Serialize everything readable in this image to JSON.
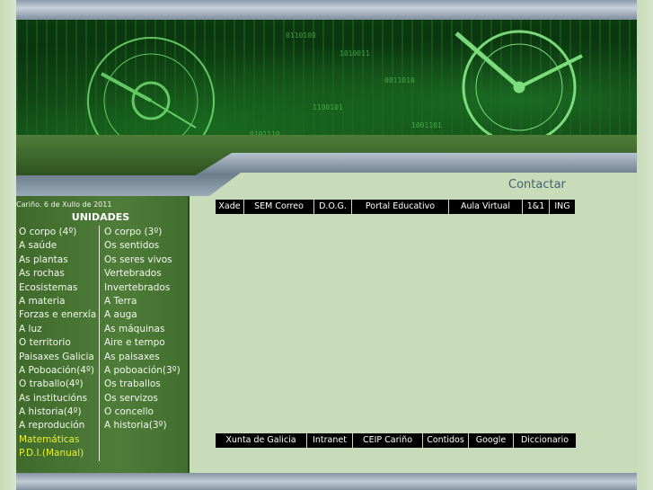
{
  "header": {
    "contact_label": "Contactar"
  },
  "sidebar": {
    "date": "Cariño. 6 de Xullo de 2011",
    "title": "UNIDADES",
    "col1": [
      "O corpo (4º)",
      "A saúde",
      "As plantas",
      "As rochas",
      "Ecosistemas",
      "A materia",
      "Forzas e enerxía",
      "A luz",
      "O territorio",
      "Paisaxes Galicia",
      "A Poboación(4º)",
      "O traballo(4º)",
      "As institucións",
      "A historia(4º)",
      "A reprodución",
      "Matemáticas",
      "P.D.I.(Manual)"
    ],
    "col2": [
      "O corpo (3º)",
      "Os sentidos",
      "Os seres vivos",
      "Vertebrados",
      "Invertebrados",
      "A Terra",
      "A auga",
      "As máquinas",
      "Aire e tempo",
      "As paisaxes",
      "A poboación(3º)",
      "Os traballos",
      "Os servizos",
      "O concello",
      "A historia(3º)"
    ]
  },
  "top_links": [
    "Xade",
    "SEM Correo",
    "D.O.G.",
    "Portal Educativo",
    "Aula Virtual",
    "1&1",
    "ING"
  ],
  "bottom_links": [
    "Xunta de Galicia",
    "Intranet",
    "CEIP Cariño",
    "Contidos",
    "Google",
    "Diccionario"
  ],
  "colors": {
    "page_bg": "#c9dcb9",
    "sidebar_bg": "#4f7d39",
    "highlight_link": "#e8f030",
    "contact": "#456070"
  }
}
